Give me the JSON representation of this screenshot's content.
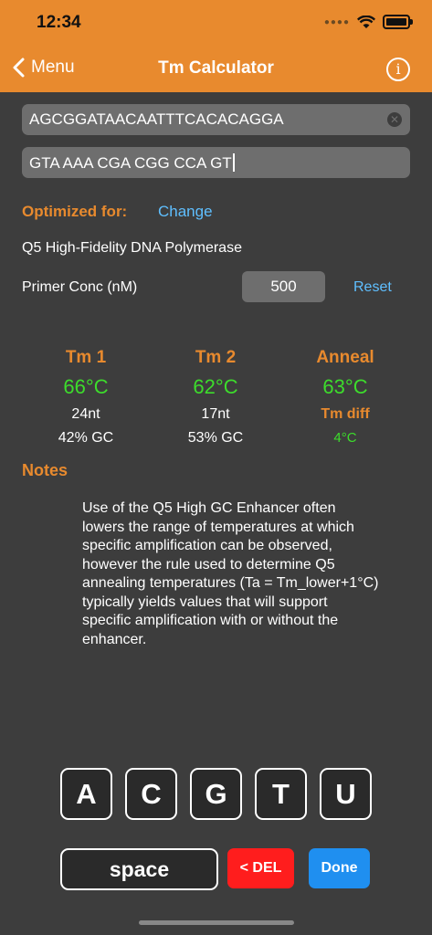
{
  "status_bar": {
    "time": "12:34",
    "icons": [
      "signal-dots",
      "wifi-icon",
      "battery-icon"
    ]
  },
  "nav": {
    "back_label": "Menu",
    "title": "Tm Calculator",
    "info_icon": "info-icon"
  },
  "primers": {
    "primer1": "AGCGGATAACAATTTCACACAGGA",
    "primer2": "GTA AAA CGA CGG CCA GT"
  },
  "optimization": {
    "label": "Optimized for:",
    "change_label": "Change",
    "polymerase": "Q5 High-Fidelity DNA Polymerase"
  },
  "primer_conc": {
    "label": "Primer Conc  (nM)",
    "value": "500",
    "reset_label": "Reset"
  },
  "results": {
    "tm1": {
      "heading": "Tm 1",
      "temp": "66°C",
      "length": "24nt",
      "gc": "42% GC"
    },
    "tm2": {
      "heading": "Tm 2",
      "temp": "62°C",
      "length": "17nt",
      "gc": "53% GC"
    },
    "anneal": {
      "heading": "Anneal",
      "temp": "63°C",
      "diff_label": "Tm diff",
      "diff_value": "4°C"
    }
  },
  "notes": {
    "title": "Notes",
    "lines": [
      "Use of the Q5 High GC Enhancer often",
      "lowers the range of temperatures at which",
      "specific amplification can be observed,",
      "however the rule used to determine Q5",
      "annealing temperatures (Ta = Tm_lower+1°C)",
      "typically yields values that will support",
      "specific amplification with or without the",
      "enhancer."
    ]
  },
  "keyboard": {
    "bases": [
      "A",
      "C",
      "G",
      "T",
      "U"
    ],
    "space": "space",
    "delete": "< DEL",
    "done": "Done"
  },
  "colors": {
    "accent": "#e88a2e",
    "background": "#3d3d3d",
    "link": "#5fbfff",
    "temp": "#3ddc2c",
    "delete": "#ff1d1d",
    "done": "#1f8ff0"
  }
}
